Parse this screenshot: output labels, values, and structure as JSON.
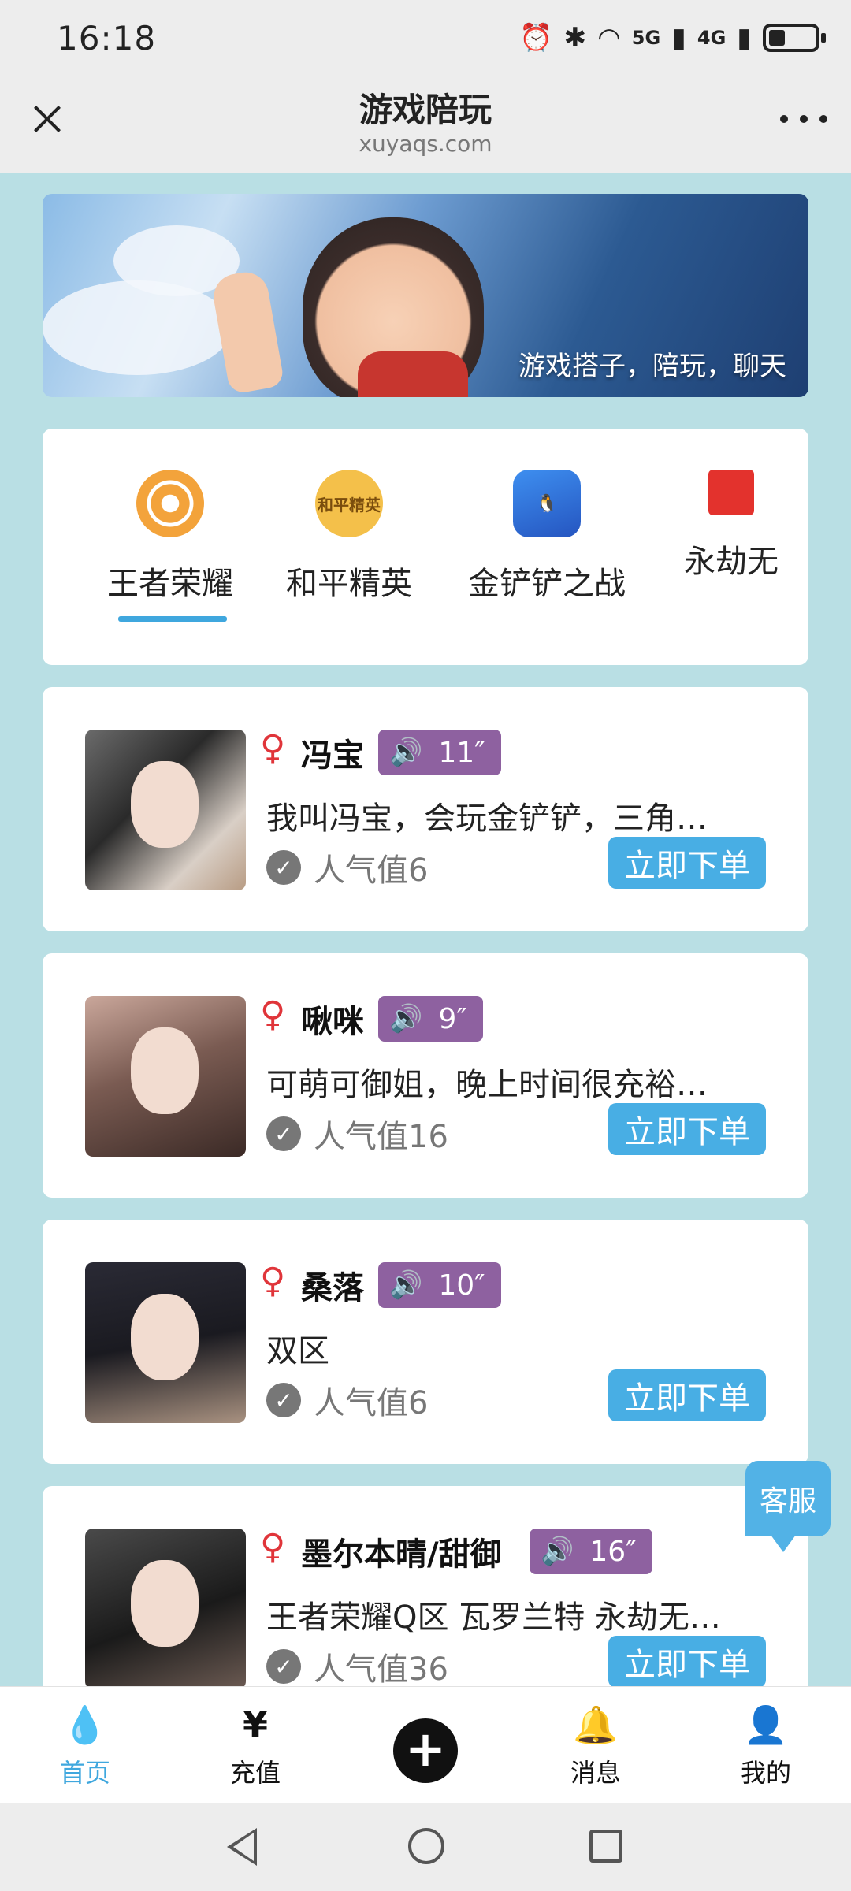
{
  "status_bar": {
    "time": "16:18",
    "net1": "5G",
    "net2": "4G"
  },
  "header": {
    "title": "游戏陪玩",
    "subtitle": "xuyaqs.com"
  },
  "banner": {
    "caption": "游戏搭子，陪玩，聊天"
  },
  "categories": [
    {
      "label": "王者荣耀",
      "icon": "honor-of-kings-icon",
      "selected": true
    },
    {
      "label": "和平精英",
      "icon": "peace-elite-icon",
      "icon_text": "和平精英"
    },
    {
      "label": "金铲铲之战",
      "icon": "golden-spatula-icon"
    },
    {
      "label": "永劫无",
      "icon": "naraka-icon"
    }
  ],
  "players": [
    {
      "name": "冯宝",
      "gender": "♀",
      "voice": "11″",
      "desc": "我叫冯宝，会玩金铲铲，三角…",
      "popularity": "人气值6",
      "button": "立即下单"
    },
    {
      "name": "啾咪",
      "gender": "♀",
      "voice": "9″",
      "desc": "可萌可御姐，晚上时间很充裕…",
      "popularity": "人气值16",
      "button": "立即下单"
    },
    {
      "name": "桑落",
      "gender": "♀",
      "voice": "10″",
      "desc": "双区",
      "popularity": "人气值6",
      "button": "立即下单"
    },
    {
      "name": "墨尔本晴/甜御",
      "gender": "♀",
      "voice": "16″",
      "desc": "王者荣耀Q区 瓦罗兰特 永劫无…",
      "popularity": "人气值36",
      "button": "立即下单"
    }
  ],
  "service": {
    "label": "客服"
  },
  "bottom_nav": {
    "home": "首页",
    "home_icon": "💧",
    "recharge": "充值",
    "recharge_icon": "¥",
    "add": "+",
    "messages": "消息",
    "messages_icon": "🔔",
    "mine": "我的",
    "mine_icon": "👤"
  },
  "colors": {
    "accent": "#3fa7de",
    "voice_badge": "#8e61a0",
    "female": "#e0353a",
    "background": "#b9dfe4"
  }
}
